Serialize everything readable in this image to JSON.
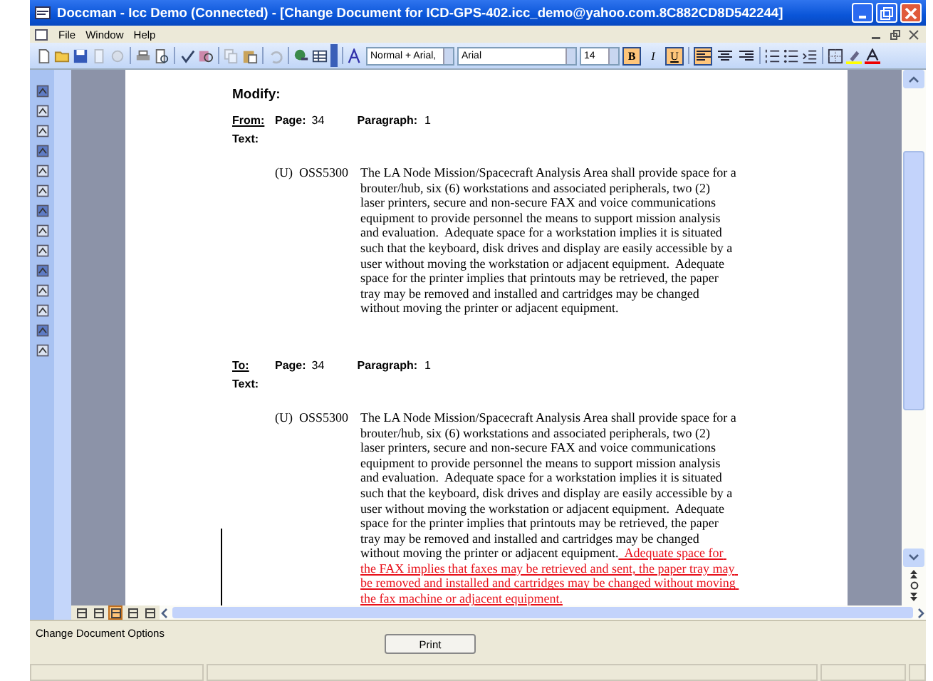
{
  "window": {
    "title": "Doccman - Icc Demo (Connected) - [Change Document for ICD-GPS-402.icc_demo@yahoo.com.8C882CD8D542244]"
  },
  "menu": [
    "File",
    "Window",
    "Help"
  ],
  "toolbar": {
    "style": "Normal + Arial,",
    "font": "Arial",
    "size": "14",
    "format_buttons": [
      {
        "label": "B",
        "selected": true
      },
      {
        "label": "I",
        "selected": false
      },
      {
        "label": "U",
        "selected": true
      }
    ],
    "alignment_buttons": [
      {
        "selected": true
      },
      {
        "selected": false
      },
      {
        "selected": false
      }
    ]
  },
  "document": {
    "heading": "Modify:",
    "sections": [
      {
        "label": "From:",
        "page_label": "Page:",
        "page": "34",
        "paragraph_label": "Paragraph:",
        "paragraph": "1",
        "text_label": "Text:",
        "marking": "(U)",
        "id": "OSS5300",
        "body": "The LA Node Mission/Spacecraft Analysis Area shall provide space for a brouter/hub, six (6) workstations and associated peripherals, two (2) laser printers, secure and non-secure FAX and voice communications equipment to provide personnel the means to support mission analysis and evaluation.  Adequate space for a workstation implies it is situated such that the keyboard, disk drives and display are easily accessible by a user without moving the workstation or adjacent equipment.  Adequate space for the printer implies that printouts may be retrieved, the paper tray may be removed and installed and cartridges may be changed without moving the printer or adjacent equipment."
      },
      {
        "label": "To:",
        "page_label": "Page:",
        "page": "34",
        "paragraph_label": "Paragraph:",
        "paragraph": "1",
        "text_label": "Text:",
        "marking": "(U)",
        "id": "OSS5300",
        "body": "The LA Node Mission/Spacecraft Analysis Area shall provide space for a brouter/hub, six (6) workstations and associated peripherals, two (2) laser printers, secure and non-secure FAX and voice communications equipment to provide personnel the means to support mission analysis and evaluation.  Adequate space for a workstation implies it is situated such that the keyboard, disk drives and display are easily accessible by a user without moving the workstation or adjacent equipment.  Adequate space for the printer implies that printouts may be retrieved, the paper tray may be removed and installed and cartridges may be changed without moving the printer or adjacent equipment.",
        "inserted": "  Adequate space for the FAX implies that faxes may be retrieved and sent, the paper tray may be removed and installed and cartridges may be changed without moving the fax machine or adjacent equipment."
      }
    ]
  },
  "view_buttons": [
    {
      "selected": false
    },
    {
      "selected": false
    },
    {
      "selected": true
    },
    {
      "selected": false
    },
    {
      "selected": false
    }
  ],
  "options_label": "Change Document Options",
  "print_button": "Print"
}
